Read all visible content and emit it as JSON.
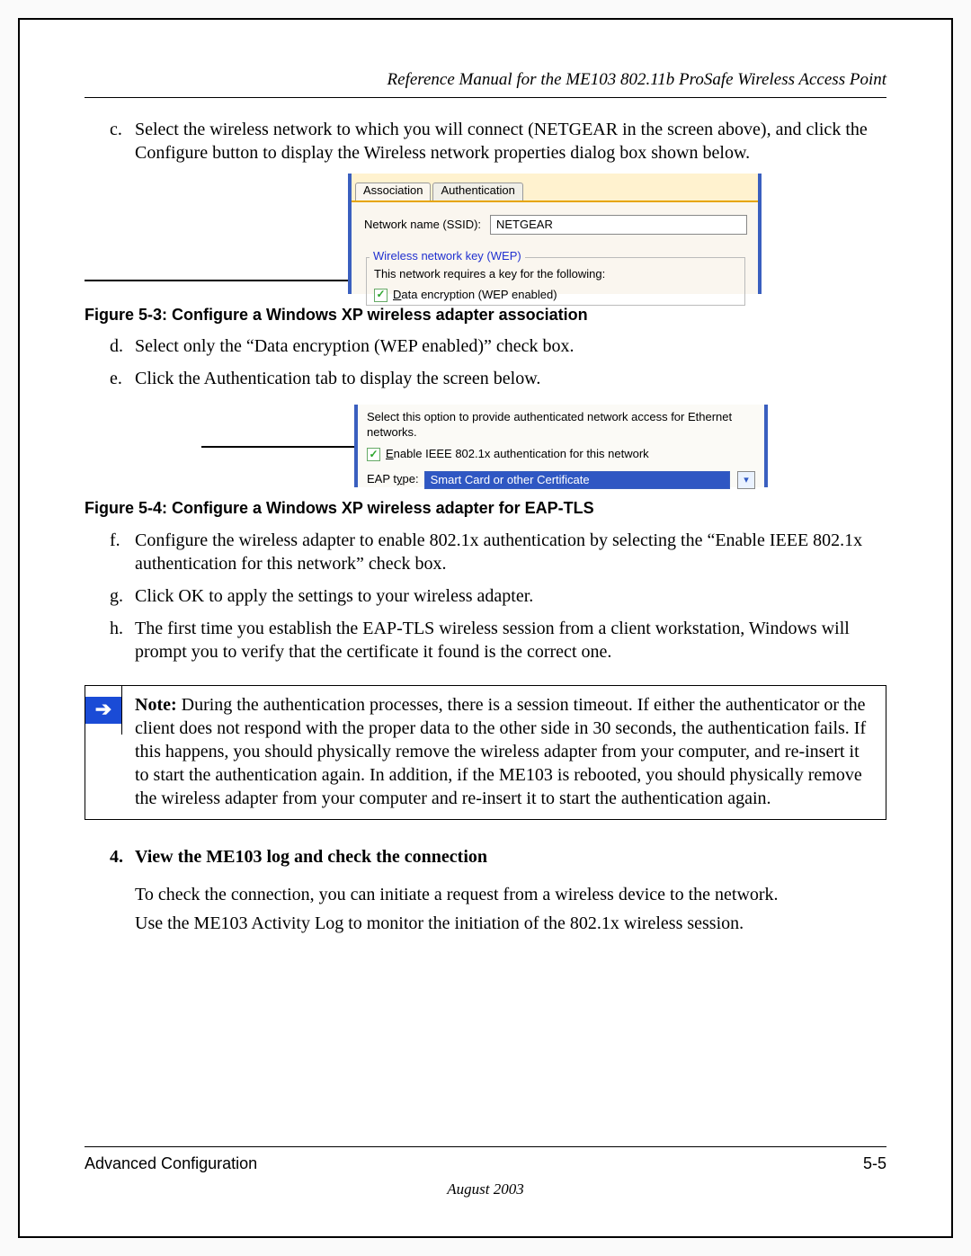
{
  "header": "Reference Manual for the ME103 802.11b ProSafe Wireless Access Point",
  "step_c": {
    "marker": "c.",
    "text": "Select the wireless network to which you will connect (NETGEAR in the screen above), and click the Configure button to display the Wireless network properties dialog box shown below."
  },
  "fig1": {
    "tabs": {
      "assoc": "Association",
      "auth": "Authentication"
    },
    "ssid_label": "Network name (SSID):",
    "ssid_value": "NETGEAR",
    "fieldset_legend": "Wireless network key (WEP)",
    "requires_text": "This network requires a key for the following:",
    "checkbox_label": "Data encryption (WEP enabled)",
    "caption": "Figure 5-3:  Configure a Windows XP wireless adapter association"
  },
  "step_d": {
    "marker": "d.",
    "text": "Select only the “Data encryption (WEP enabled)” check box."
  },
  "step_e": {
    "marker": "e.",
    "text": "Click the Authentication tab to display the screen below."
  },
  "fig2": {
    "intro": "Select this option to provide authenticated network access for Ethernet networks.",
    "checkbox_label": "Enable IEEE 802.1x authentication for this network",
    "eap_label": "EAP type:",
    "eap_value": "Smart Card or other Certificate",
    "caption": "Figure 5-4:  Configure a Windows XP wireless adapter for EAP-TLS"
  },
  "step_f": {
    "marker": "f.",
    "text": "Configure the wireless adapter to enable 802.1x authentication by selecting the “Enable IEEE 802.1x authentication for this network” check box."
  },
  "step_g": {
    "marker": "g.",
    "text": "Click OK to apply the settings to your wireless adapter."
  },
  "step_h": {
    "marker": "h.",
    "text": "The first time you establish the EAP-TLS wireless session from a client workstation, Windows will prompt you to verify that the certificate it found is the correct one."
  },
  "note": {
    "label": "Note:",
    "body": " During the authentication processes, there is a session timeout. If either the authenticator or the client does not respond with the proper data to the other side in 30 seconds, the authentication fails. If this happens, you should physically remove the wireless adapter from your computer, and re-insert it to start the authentication again. In addition, if the ME103 is rebooted, you should physically remove the wireless adapter from your computer and re-insert it to start the authentication again."
  },
  "step4_heading": "View the ME103 log and check the connection",
  "step4_num": "4.",
  "step4_p1": "To check the connection, you can initiate a request from a wireless device to the network.",
  "step4_p2": "Use the ME103 Activity Log to monitor the initiation of the 802.1x wireless session.",
  "footer": {
    "section": "Advanced Configuration",
    "pagenum": "5-5",
    "date": "August 2003"
  }
}
